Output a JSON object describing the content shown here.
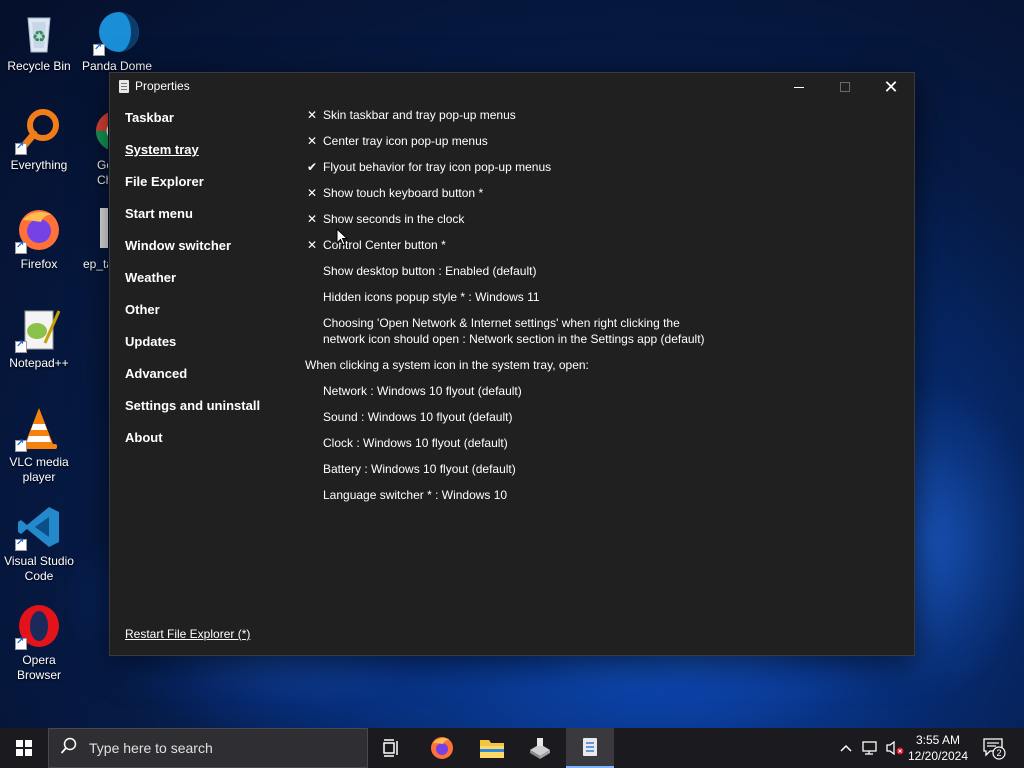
{
  "desktop": {
    "icons": [
      {
        "label": "Recycle Bin",
        "icon": "recycle-bin-icon"
      },
      {
        "label": "Panda Dome",
        "icon": "panda-dome-icon"
      },
      {
        "label": "Everything",
        "icon": "everything-search-icon"
      },
      {
        "label": "Go Ch",
        "icon": "google-chrome-icon"
      },
      {
        "label": "Firefox",
        "icon": "firefox-icon"
      },
      {
        "label": "ep_ta",
        "icon": "file-icon"
      },
      {
        "label": "Notepad++",
        "icon": "notepad-plus-plus-icon"
      },
      {
        "label": "VLC media player",
        "icon": "vlc-icon"
      },
      {
        "label": "Visual Studio Code",
        "icon": "vscode-icon"
      },
      {
        "label": "Opera Browser",
        "icon": "opera-icon"
      }
    ]
  },
  "window": {
    "title": "Properties",
    "close_glyph": "✕",
    "nav": [
      {
        "label": "Taskbar",
        "active": false
      },
      {
        "label": "System tray",
        "active": true
      },
      {
        "label": "File Explorer",
        "active": false
      },
      {
        "label": "Start menu",
        "active": false
      },
      {
        "label": "Window switcher",
        "active": false
      },
      {
        "label": "Weather",
        "active": false
      },
      {
        "label": "Other",
        "active": false
      },
      {
        "label": "Updates",
        "active": false
      },
      {
        "label": "Advanced",
        "active": false
      },
      {
        "label": "Settings and uninstall",
        "active": false
      },
      {
        "label": "About",
        "active": false
      }
    ],
    "restart_link": "Restart File Explorer (*)",
    "options": [
      {
        "mark": "✕",
        "label": "Skin taskbar and tray pop-up menus"
      },
      {
        "mark": "✕",
        "label": "Center tray icon pop-up menus"
      },
      {
        "mark": "✔",
        "label": "Flyout behavior for tray icon pop-up menus"
      },
      {
        "mark": "✕",
        "label": "Show touch keyboard button *"
      },
      {
        "mark": "✕",
        "label": "Show seconds in the clock"
      },
      {
        "mark": "✕",
        "label": "Control Center button *"
      }
    ],
    "settings": [
      {
        "label": "Show desktop button : Enabled (default)"
      },
      {
        "label": "Hidden icons popup style * : Windows 11"
      },
      {
        "label": "Choosing 'Open Network & Internet settings' when right clicking the network icon should open : Network section in the Settings app (default)"
      }
    ],
    "systray_heading": "When clicking a system icon in the system tray, open:",
    "systray_options": [
      {
        "label": "Network : Windows 10 flyout (default)"
      },
      {
        "label": "Sound : Windows 10 flyout (default)"
      },
      {
        "label": "Clock : Windows 10 flyout (default)"
      },
      {
        "label": "Battery : Windows 10 flyout (default)"
      },
      {
        "label": "Language switcher * : Windows 10"
      }
    ]
  },
  "taskbar": {
    "search_placeholder": "Type here to search",
    "apps": [
      "task-view-icon",
      "firefox-icon",
      "file-explorer-icon",
      "app-icon",
      "properties-icon"
    ],
    "clock_time": "3:55 AM",
    "clock_date": "12/20/2024",
    "notification_count": "2"
  }
}
